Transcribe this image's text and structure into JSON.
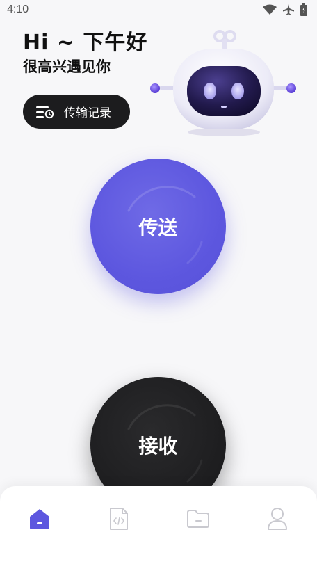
{
  "status_bar": {
    "time": "4:10",
    "icons": [
      "wifi-icon",
      "airplane-icon",
      "battery-icon"
    ]
  },
  "greeting": {
    "title": "Hi ~ 下午好",
    "subtitle": "很高兴遇见你"
  },
  "history_button": {
    "label": "传输记录",
    "icon": "history-list-icon"
  },
  "mascot": "robot-illustration",
  "actions": {
    "send_label": "传送",
    "receive_label": "接收"
  },
  "tabbar": {
    "items": [
      {
        "icon": "home-icon",
        "active": true
      },
      {
        "icon": "code-file-icon",
        "active": false
      },
      {
        "icon": "folder-icon",
        "active": false
      },
      {
        "icon": "user-icon",
        "active": false
      }
    ]
  },
  "colors": {
    "accent": "#5d57df",
    "dark": "#1c1c1e",
    "background": "#f7f7f9",
    "inactive_icon": "#c9c9cf"
  }
}
